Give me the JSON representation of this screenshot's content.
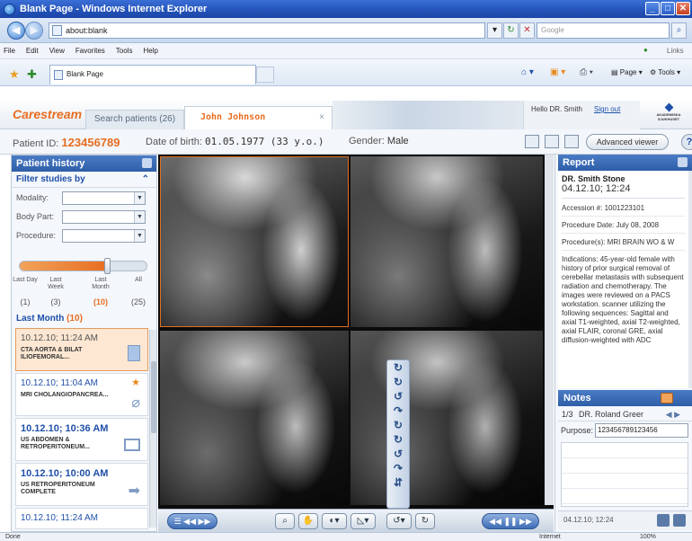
{
  "window": {
    "title": "Blank Page - Windows Internet Explorer"
  },
  "browser": {
    "address": "about:blank",
    "search_placeholder": "Google",
    "menu": [
      "File",
      "Edit",
      "View",
      "Favorites",
      "Tools",
      "Help"
    ],
    "links_label": "Links",
    "tab_title": "Blank Page",
    "page_btn": "Page",
    "tools_btn": "Tools",
    "status": {
      "left": "Done",
      "zone": "Internet",
      "zoom": "100%"
    }
  },
  "app": {
    "logo": "Carestream",
    "tabs": {
      "search": "Search patients (26)",
      "patient": "John Johnson",
      "close": "×"
    },
    "user": {
      "hello": "Hello DR. Smith",
      "signout": "Sign out"
    },
    "org": "AKADEMISKA SJUKHUSET"
  },
  "patient": {
    "id_label": "Patient ID:",
    "id": "123456789",
    "dob_label": "Date of birth:",
    "dob": "01.05.1977 (33 y.o.)",
    "gender_label": "Gender:",
    "gender": "Male",
    "advanced_viewer": "Advanced viewer",
    "help": "?"
  },
  "history": {
    "title": "Patient history",
    "filter_title": "Filter studies by",
    "filters": [
      {
        "label": "Modality:",
        "value": ""
      },
      {
        "label": "Body Part:",
        "value": ""
      },
      {
        "label": "Procedure:",
        "value": ""
      }
    ],
    "ranges": [
      {
        "label": "Last Day",
        "count": "(1)"
      },
      {
        "label": "Last Week",
        "count": "(3)"
      },
      {
        "label": "Last Month",
        "count": "(10)"
      },
      {
        "label": "All",
        "count": "(25)"
      }
    ],
    "slider_level": 0.7,
    "group_label": "Last Month",
    "group_count": "(10)",
    "studies": [
      {
        "time": "10.12.10; 11:24 AM",
        "desc": "CTA AORTA & BILAT ILIOFEMORAL...",
        "selected": true
      },
      {
        "time": "10.12.10; 11:04 AM",
        "desc": "MRI CHOLANGIOPANCREA...",
        "selected": false
      },
      {
        "time": "10.12.10; 10:36 AM",
        "desc": "US ABDOMEN & RETROPERITONEUM...",
        "selected": false
      },
      {
        "time": "10.12.10; 10:00 AM",
        "desc": "US RETROPERITONEUM COMPLETE",
        "selected": false
      },
      {
        "time": "10.12.10; 11:24 AM",
        "desc": "",
        "selected": false
      }
    ]
  },
  "report": {
    "title": "Report",
    "doctor": "DR. Smith Stone",
    "datetime": "04.12.10; 12:24",
    "accession": "Accession #: 1001223101",
    "procedure_date": "Procedure Date: July 08, 2008",
    "procedures": "Procedure(s): MRI BRAIN WO & W",
    "indications": "Indications: 45-year-old female with history of prior surgical removal of cerebellar metastasis with subsequent radiation and chemotherapy. The images were reviewed on a PACS workstation. scanner utilizing the following sequences: Sagittal and axial T1-weighted, axial T2-weighted, axial FLAIR, coronal GRE, axial diffusion-weighted with ADC"
  },
  "notes": {
    "title": "Notes",
    "nav": "1/3",
    "author": "DR. Roland Greer",
    "purpose_label": "Purpose:",
    "purpose_value": "123456789123456",
    "footer_date": "04.12.10; 12:24"
  }
}
